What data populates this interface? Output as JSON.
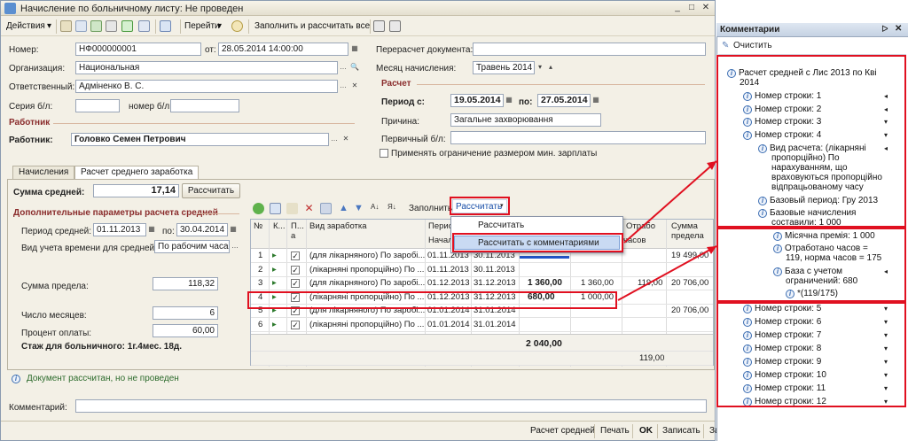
{
  "window": {
    "title": "Начисление по больничному листу: Не проведен"
  },
  "toolbar": {
    "actions": "Действия",
    "go": "Перейти",
    "fill_calc": "Заполнить и рассчитать все"
  },
  "form": {
    "number_label": "Номер:",
    "number": "НФ000000001",
    "from_label": "от:",
    "date": "28.05.2014 14:00:00",
    "org_label": "Организация:",
    "org": "Национальная",
    "resp_label": "Ответственный:",
    "resp": "Адміненко В. С.",
    "series_label": "Серия б/л:",
    "series": "",
    "number_bl_label": "номер б/л",
    "number_bl": "",
    "worker_header": "Работник",
    "worker_label": "Работник:",
    "worker": "Головко Семен Петрович",
    "recalc_label": "Перерасчет документа:",
    "recalc": "",
    "month_label": "Месяц начисления:",
    "month": "Травень 2014",
    "calc_header": "Расчет",
    "period_label": "Период с:",
    "period_from": "19.05.2014",
    "period_to_label": "по:",
    "period_to": "27.05.2014",
    "reason_label": "Причина:",
    "reason": "Загальне захворювання",
    "primary_label": "Первичный б/л:",
    "primary": "",
    "min_wage_checkbox": "Применять ограничение размером мин. зарплаты"
  },
  "tabs": [
    {
      "label": "Начисления"
    },
    {
      "label": "Расчет среднего заработка"
    }
  ],
  "avg": {
    "sum_label": "Сумма средней:",
    "sum": "17,14",
    "calc_button": "Рассчитать",
    "params_header": "Дополнительные параметры расчета средней",
    "period_label": "Период средней:",
    "period_from": "01.11.2013",
    "period_to_label": "по:",
    "period_to": "30.04.2014",
    "time_type_label": "Вид учета времени для средней:",
    "time_type": "По рабочим часам",
    "limit_label": "Сумма предела:",
    "limit": "118,32",
    "months_label": "Число месяцев:",
    "months": "6",
    "pct_label": "Процент оплаты:",
    "pct": "60,00",
    "stazh": "Стаж для больничного: 1г.4мес. 18д."
  },
  "grid": {
    "fill_label": "Заполнить",
    "calc_label": "Рассчитать",
    "headers": {
      "n": "№",
      "k": "К...",
      "p": "П... а",
      "vid": "Вид заработка",
      "period": "Период",
      "start": "Начал",
      "hours": "часов",
      "otrab": "Отрабо",
      "limit": "Сумма предела"
    },
    "rows": [
      {
        "n": "1",
        "vid": "(для лікарняного) По заробі...",
        "from": "01.11.2013",
        "to": "30.11.2013",
        "sum": "",
        "s2": "",
        "h": "",
        "lim": "19 499,00"
      },
      {
        "n": "2",
        "vid": "(лікарняні пропорційно) По ...",
        "from": "01.11.2013",
        "to": "30.11.2013",
        "sum": "",
        "s2": "",
        "h": "",
        "lim": ""
      },
      {
        "n": "3",
        "vid": "(для лікарняного) По заробі...",
        "from": "01.12.2013",
        "to": "31.12.2013",
        "sum": "1 360,00",
        "s2": "1 360,00",
        "h": "119,00",
        "lim": "20 706,00"
      },
      {
        "n": "4",
        "vid": "(лікарняні пропорційно) По ...",
        "from": "01.12.2013",
        "to": "31.12.2013",
        "sum": "680,00",
        "s2": "1 000,00",
        "h": "",
        "lim": ""
      },
      {
        "n": "5",
        "vid": "(для лікарняного) По заробі...",
        "from": "01.01.2014",
        "to": "31.01.2014",
        "sum": "",
        "s2": "",
        "h": "",
        "lim": "20 706,00"
      },
      {
        "n": "6",
        "vid": "(лікарняні пропорційно) По ...",
        "from": "01.01.2014",
        "to": "31.01.2014",
        "sum": "",
        "s2": "",
        "h": "",
        "lim": ""
      }
    ],
    "total": "2 040,00",
    "total_hours": "119,00"
  },
  "menu": {
    "items": [
      {
        "label": "Рассчитать"
      },
      {
        "label": "Рассчитать с комментариями"
      }
    ]
  },
  "status": {
    "info": "Документ рассчитан, но не проведен",
    "comment_label": "Комментарий:",
    "comment": ""
  },
  "footer": {
    "avg": "Расчет средней",
    "print": "Печать",
    "ok": "OK",
    "save": "Записать",
    "close": "Закрыть"
  },
  "comments": {
    "title": "Комментарии",
    "clear": "Очистить",
    "items": [
      "Расчет средней с Лис 2013 по Кві",
      "2014",
      "Номер строки: 1",
      "Номер строки: 2",
      "Номер строки: 3",
      "Номер строки: 4",
      "Вид расчета: (лікарняні",
      "пропорційно) По",
      "нарахуванням, що",
      "враховуються пропорційно",
      "відпрацьованому часу",
      "Базовый период: Гру 2013",
      "Базовые начисления",
      "составили: 1 000",
      "Місячна премія: 1 000",
      "Отработано часов =",
      "119, норма часов = 175",
      "База с учетом",
      "ограничений: 680",
      "*(119/175)",
      "Номер строки: 5",
      "Номер строки: 6",
      "Номер строки: 7",
      "Номер строки: 8",
      "Номер строки: 9",
      "Номер строки: 10",
      "Номер строки: 11",
      "Номер строки: 12"
    ]
  }
}
